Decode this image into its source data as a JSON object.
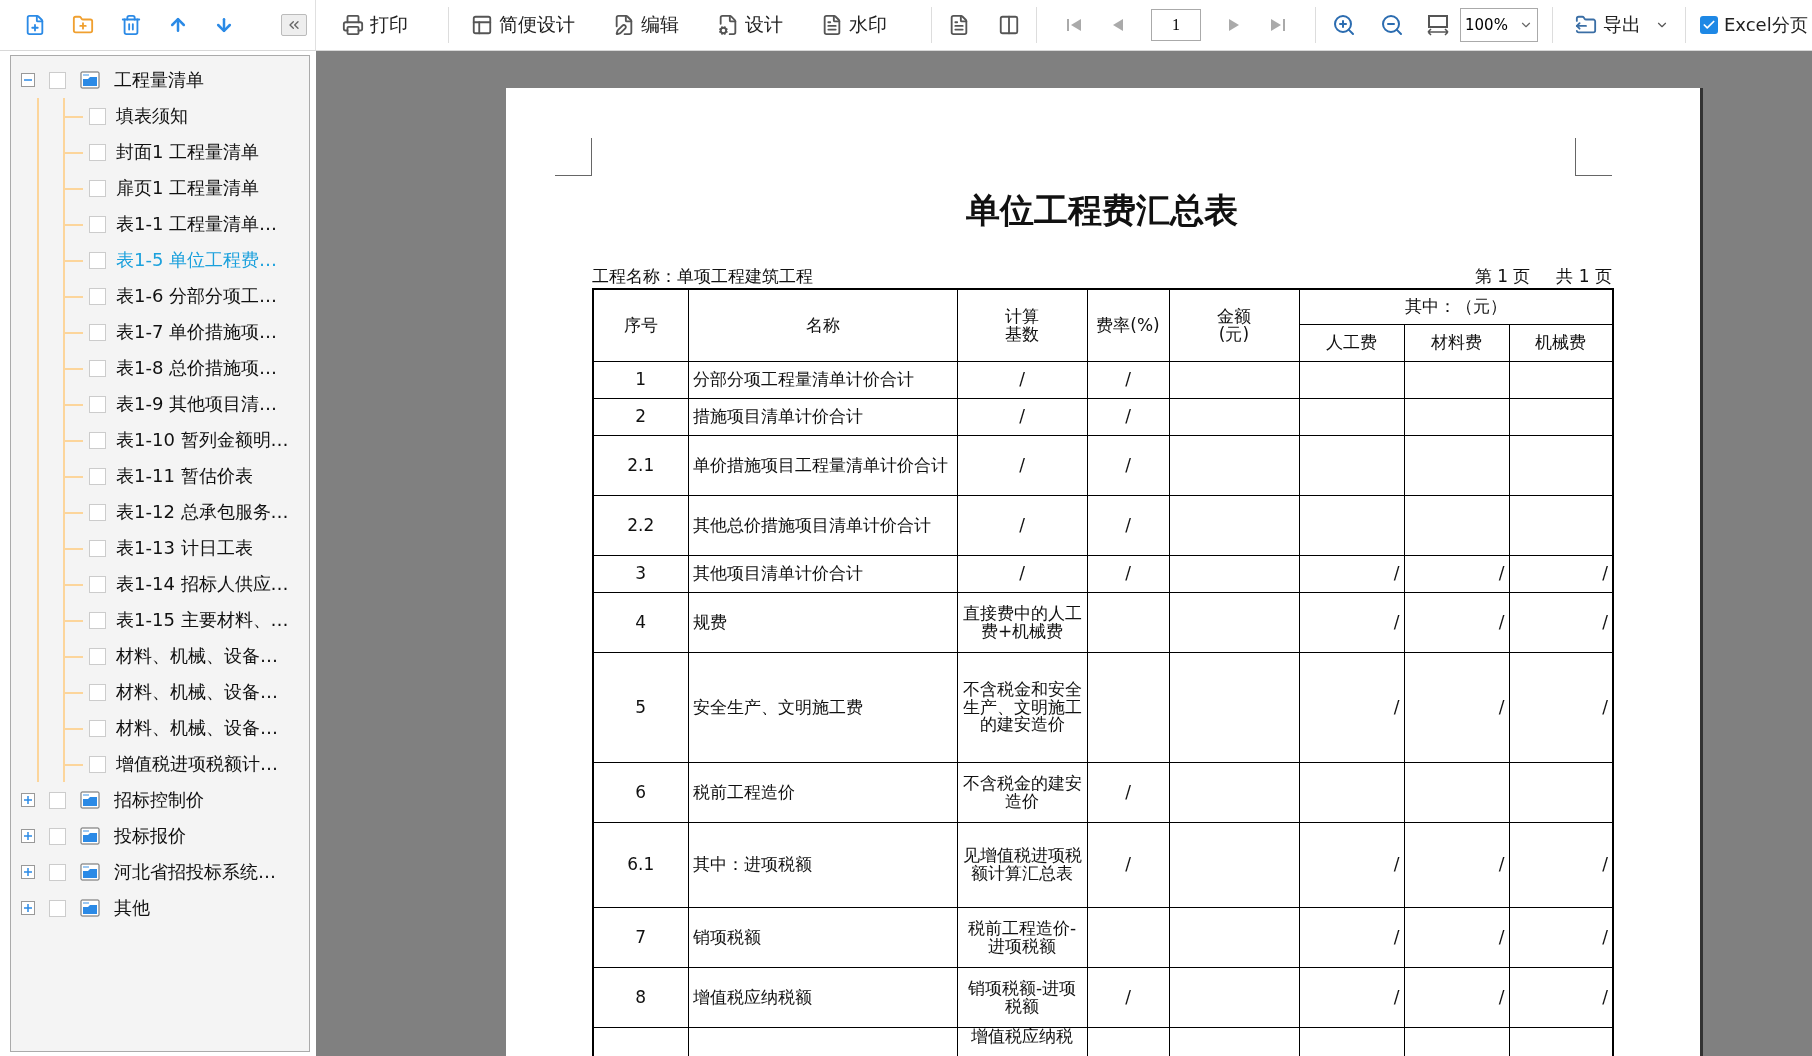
{
  "toolbar": {
    "buttons": [
      {
        "label": "打印"
      },
      {
        "label": "简便设计"
      },
      {
        "label": "编辑"
      },
      {
        "label": "设计"
      },
      {
        "label": "水印"
      }
    ],
    "page_input": "1",
    "zoom": "100%",
    "export": "导出",
    "excel_split": {
      "label": "Excel分页",
      "checked": true
    }
  },
  "sidebar": {
    "tree": [
      {
        "label": "工程量清单",
        "checked": false,
        "expanded": true,
        "children": [
          {
            "label": "填表须知",
            "checked": false,
            "selected": false
          },
          {
            "label": "封面1 工程量清单",
            "checked": false,
            "selected": false
          },
          {
            "label": "扉页1 工程量清单",
            "checked": false,
            "selected": false
          },
          {
            "label": "表1-1 工程量清单…",
            "checked": false,
            "selected": false
          },
          {
            "label": "表1-5 单位工程费…",
            "checked": false,
            "selected": true
          },
          {
            "label": "表1-6 分部分项工…",
            "checked": false,
            "selected": false
          },
          {
            "label": "表1-7 单价措施项…",
            "checked": false,
            "selected": false
          },
          {
            "label": "表1-8 总价措施项…",
            "checked": false,
            "selected": false
          },
          {
            "label": "表1-9 其他项目清…",
            "checked": false,
            "selected": false
          },
          {
            "label": "表1-10 暂列金额明…",
            "checked": false,
            "selected": false
          },
          {
            "label": "表1-11 暂估价表",
            "checked": false,
            "selected": false
          },
          {
            "label": "表1-12 总承包服务…",
            "checked": false,
            "selected": false
          },
          {
            "label": "表1-13 计日工表",
            "checked": false,
            "selected": false
          },
          {
            "label": "表1-14 招标人供应…",
            "checked": false,
            "selected": false
          },
          {
            "label": "表1-15 主要材料、…",
            "checked": false,
            "selected": false
          },
          {
            "label": "材料、机械、设备…",
            "checked": false,
            "selected": false
          },
          {
            "label": "材料、机械、设备…",
            "checked": false,
            "selected": false
          },
          {
            "label": "材料、机械、设备…",
            "checked": false,
            "selected": false
          },
          {
            "label": "增值税进项税额计…",
            "checked": false,
            "selected": false
          }
        ]
      },
      {
        "label": "招标控制价",
        "checked": false,
        "expanded": false
      },
      {
        "label": "投标报价",
        "checked": false,
        "expanded": false
      },
      {
        "label": "河北省招投标系统…",
        "checked": false,
        "expanded": false
      },
      {
        "label": "其他",
        "checked": false,
        "expanded": false
      }
    ]
  },
  "document": {
    "title": "单位工程费汇总表",
    "project": "工程名称：单项工程建筑工程",
    "page_no": "第 1 页",
    "page_total": "共 1 页",
    "columns": [
      {
        "label": "序号",
        "kind": "plain"
      },
      {
        "label": "名称",
        "kind": "plain"
      },
      {
        "label": "计算基数",
        "kind": "stacked"
      },
      {
        "label": "费率(%)",
        "kind": "plain"
      },
      {
        "label": "金额(元)",
        "kind": "stacked"
      },
      {
        "label": "其中：（元）",
        "kind": "group",
        "children": [
          "人工费",
          "材料费",
          "机械费"
        ]
      }
    ],
    "rows": [
      {
        "seq": "1",
        "name": "分部分项工程量清单计价合计",
        "calc": "/",
        "rate": "/"
      },
      {
        "seq": "2",
        "name": "措施项目清单计价合计",
        "calc": "/",
        "rate": "/"
      },
      {
        "seq": "2.1",
        "name": "单价措施项目工程量清单计价合计",
        "calc": "/",
        "rate": "/"
      },
      {
        "seq": "2.2",
        "name": "其他总价措施项目清单计价合计",
        "calc": "/",
        "rate": "/"
      },
      {
        "seq": "3",
        "name": "其他项目清单计价合计",
        "calc": "/",
        "rate": "/",
        "labor": "/",
        "material": "/",
        "machine": "/"
      },
      {
        "seq": "4",
        "name": "规费",
        "calc": "直接费中的人工费+机械费",
        "labor": "/",
        "material": "/",
        "machine": "/"
      },
      {
        "seq": "5",
        "name": "安全生产、文明施工费",
        "calc": "不含税金和安全生产、文明施工的建安造价",
        "labor": "/",
        "material": "/",
        "machine": "/"
      },
      {
        "seq": "6",
        "name": "税前工程造价",
        "calc": "不含税金的建安造价",
        "rate": "/"
      },
      {
        "seq": "6.1",
        "name": "其中：进项税额",
        "calc": "见增值税进项税额计算汇总表",
        "rate": "/",
        "labor": "/",
        "material": "/",
        "machine": "/"
      },
      {
        "seq": "7",
        "name": "销项税额",
        "calc": "税前工程造价-进项税额",
        "labor": "/",
        "material": "/",
        "machine": "/"
      },
      {
        "seq": "8",
        "name": "增值税应纳税额",
        "calc": "销项税额-进项税额",
        "rate": "/",
        "labor": "/",
        "material": "/",
        "machine": "/"
      },
      {
        "calc": "增值税应纳税"
      }
    ]
  }
}
